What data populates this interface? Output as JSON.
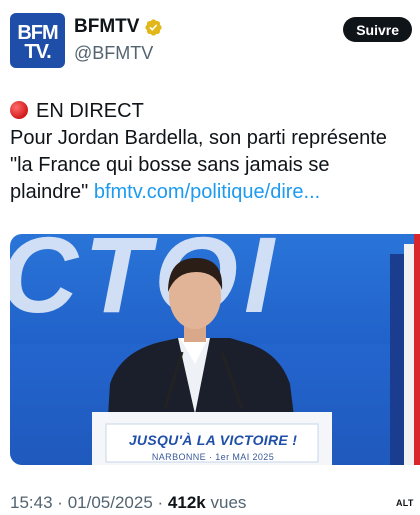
{
  "account": {
    "avatar_line1": "BFM",
    "avatar_line2": "TV.",
    "display_name": "BFMTV",
    "handle": "@BFMTV",
    "verified_color": "#e2b719",
    "follow_label": "Suivre"
  },
  "tweet": {
    "live_label": "EN DIRECT",
    "body_text": "Pour Jordan Bardella, son parti représente \"la France qui bosse sans jamais se plaindre\"",
    "link_text": "bfmtv.com/politique/dire...",
    "link_color": "#1d9bf0"
  },
  "media": {
    "banner_title": "JUSQU'À LA VICTOIRE !",
    "banner_subtitle": "NARBONNE · 1er MAI 2025",
    "backdrop_letters": "CTOI",
    "alt_badge": "ALT"
  },
  "meta": {
    "time": "15:43",
    "date": "01/05/2025",
    "views_count": "412k",
    "views_label": "vues"
  }
}
